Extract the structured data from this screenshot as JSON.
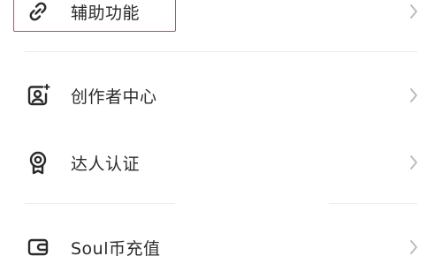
{
  "menu": {
    "items": [
      {
        "label": "辅助功能",
        "icon": "link-icon"
      },
      {
        "label": "创作者中心",
        "icon": "creator-icon"
      },
      {
        "label": "达人认证",
        "icon": "badge-icon"
      },
      {
        "label": "Soul币充值",
        "icon": "wallet-icon"
      }
    ]
  },
  "colors": {
    "text": "#2b2b2b",
    "icon": "#2b2b2b",
    "chevron": "#b8b8b8",
    "divider": "#ececec",
    "highlight": "#d64545"
  }
}
